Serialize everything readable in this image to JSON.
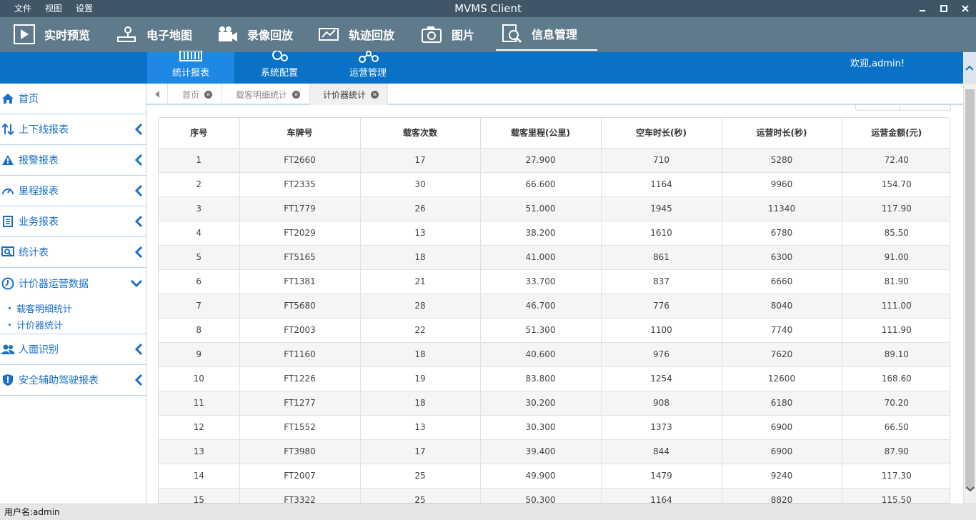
{
  "menu": [
    "文件",
    "视图",
    "设置"
  ],
  "app_title": "MVMS Client",
  "toolbar": {
    "items": [
      {
        "label": "实时预览",
        "icon": "play-icon"
      },
      {
        "label": "电子地图",
        "icon": "map-pin-icon"
      },
      {
        "label": "录像回放",
        "icon": "video-camera-icon"
      },
      {
        "label": "轨迹回放",
        "icon": "route-icon"
      },
      {
        "label": "图片",
        "icon": "photo-camera-icon"
      },
      {
        "label": "信息管理",
        "icon": "info-search-icon"
      }
    ],
    "active": "信息管理"
  },
  "subnav": {
    "tabs": [
      {
        "label": "统计报表",
        "icon": "bar-chart-icon"
      },
      {
        "label": "系统配置",
        "icon": "gears-icon"
      },
      {
        "label": "运营管理",
        "icon": "network-icon"
      }
    ],
    "active": "统计报表",
    "welcome": "欢迎,admin!"
  },
  "sidebar": {
    "items": [
      {
        "label": "首页",
        "icon": "home-icon"
      },
      {
        "label": "上下线报表",
        "icon": "up-down-icon"
      },
      {
        "label": "报警报表",
        "icon": "warning-icon"
      },
      {
        "label": "里程报表",
        "icon": "gauge-icon"
      },
      {
        "label": "业务报表",
        "icon": "document-icon"
      },
      {
        "label": "统计表",
        "icon": "search-icon"
      },
      {
        "label": "计价器运营数据",
        "icon": "clock-icon"
      },
      {
        "label": "人面识别",
        "icon": "users-icon"
      },
      {
        "label": "安全辅助驾驶报表",
        "icon": "shield-icon"
      }
    ],
    "sub_items": [
      "载客明细统计",
      "计价器统计"
    ]
  },
  "content_tabs": [
    "首页",
    "载客明细统计",
    "计价器统计"
  ],
  "active_content_tab": "计价器统计",
  "table": {
    "headers": [
      "序号",
      "车牌号",
      "载客次数",
      "载客里程(公里)",
      "空车时长(秒)",
      "运营时长(秒)",
      "运营金额(元)"
    ],
    "rows": [
      [
        "1",
        "FT2660",
        "17",
        "27.900",
        "710",
        "5280",
        "72.40"
      ],
      [
        "2",
        "FT2335",
        "30",
        "66.600",
        "1164",
        "9960",
        "154.70"
      ],
      [
        "3",
        "FT1779",
        "26",
        "51.000",
        "1945",
        "11340",
        "117.90"
      ],
      [
        "4",
        "FT2029",
        "13",
        "38.200",
        "1610",
        "6780",
        "85.50"
      ],
      [
        "5",
        "FT5165",
        "18",
        "41.000",
        "861",
        "6300",
        "91.00"
      ],
      [
        "6",
        "FT1381",
        "21",
        "33.700",
        "837",
        "6660",
        "81.90"
      ],
      [
        "7",
        "FT5680",
        "28",
        "46.700",
        "776",
        "8040",
        "111.00"
      ],
      [
        "8",
        "FT2003",
        "22",
        "51.300",
        "1100",
        "7740",
        "111.90"
      ],
      [
        "9",
        "FT1160",
        "18",
        "40.600",
        "976",
        "7620",
        "89.10"
      ],
      [
        "10",
        "FT1226",
        "19",
        "83.800",
        "1254",
        "12600",
        "168.60"
      ],
      [
        "11",
        "FT1277",
        "18",
        "30.200",
        "908",
        "6180",
        "70.20"
      ],
      [
        "12",
        "FT1552",
        "13",
        "30.300",
        "1373",
        "6900",
        "66.50"
      ],
      [
        "13",
        "FT3980",
        "17",
        "39.400",
        "844",
        "6900",
        "87.90"
      ],
      [
        "14",
        "FT2007",
        "25",
        "49.900",
        "1479",
        "9240",
        "117.30"
      ],
      [
        "15",
        "FT3322",
        "25",
        "50.300",
        "1164",
        "8820",
        "115.50"
      ]
    ]
  },
  "status_bar": "用户名:admin",
  "colors": {
    "titlebar": "#3e5666",
    "toolbar": "#5e7a8b",
    "subnav": "#0a72c6",
    "subnav_active": "#1e88e5",
    "sidebar_text": "#1a6fc7",
    "row_stripe": "#f5f5f5"
  }
}
